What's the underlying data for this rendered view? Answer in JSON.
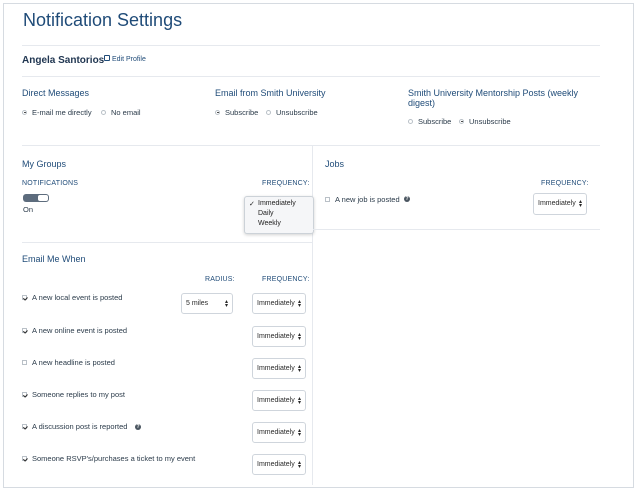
{
  "page": {
    "title": "Notification Settings"
  },
  "profile": {
    "name": "Angela Santorios",
    "edit_label": "Edit Profile"
  },
  "direct_messages": {
    "title": "Direct Messages",
    "options": [
      "E-mail me directly",
      "No email"
    ],
    "selected": 0
  },
  "email_university": {
    "title": "Email from Smith University",
    "options": [
      "Subscribe",
      "Unsubscribe"
    ],
    "selected": 0
  },
  "mentorship": {
    "title_line1": "Smith University Mentorship Posts (weekly",
    "title_line2": "digest)",
    "options": [
      "Subscribe",
      "Unsubscribe"
    ],
    "selected": 1
  },
  "groups": {
    "title": "My Groups",
    "notifications_label": "NOTIFICATIONS",
    "frequency_label": "FREQUENCY:",
    "toggle_state": "On"
  },
  "dropdown": {
    "options": [
      "Immediately",
      "Daily",
      "Weekly"
    ],
    "selected": 0
  },
  "jobs": {
    "title": "Jobs",
    "frequency_label": "FREQUENCY:",
    "item_label": "A new job is posted",
    "frequency_value": "Immediately"
  },
  "email_me": {
    "title": "Email Me When",
    "radius_label": "RADIUS:",
    "frequency_label": "FREQUENCY:",
    "items": [
      {
        "label": "A new local event is posted",
        "checked": true,
        "radius": "5 miles",
        "frequency": "Immediately"
      },
      {
        "label": "A new online event is posted",
        "checked": true,
        "frequency": "Immediately"
      },
      {
        "label": "A new headline is posted",
        "checked": false,
        "frequency": "Immediately"
      },
      {
        "label": "Someone replies to my post",
        "checked": true,
        "frequency": "Immediately"
      },
      {
        "label": "A discussion post is reported",
        "checked": true,
        "frequency": "Immediately"
      },
      {
        "label": "Someone RSVP's/purchases a ticket to my event",
        "checked": true,
        "frequency": "Immediately"
      }
    ]
  },
  "icons": {
    "edit": "edit-icon",
    "help": "help-icon",
    "check": "check-icon",
    "arrows": "select-arrows-icon"
  },
  "colors": {
    "title": "#1f4b78",
    "text": "#2b3b4a",
    "border": "#d6dbe1"
  }
}
